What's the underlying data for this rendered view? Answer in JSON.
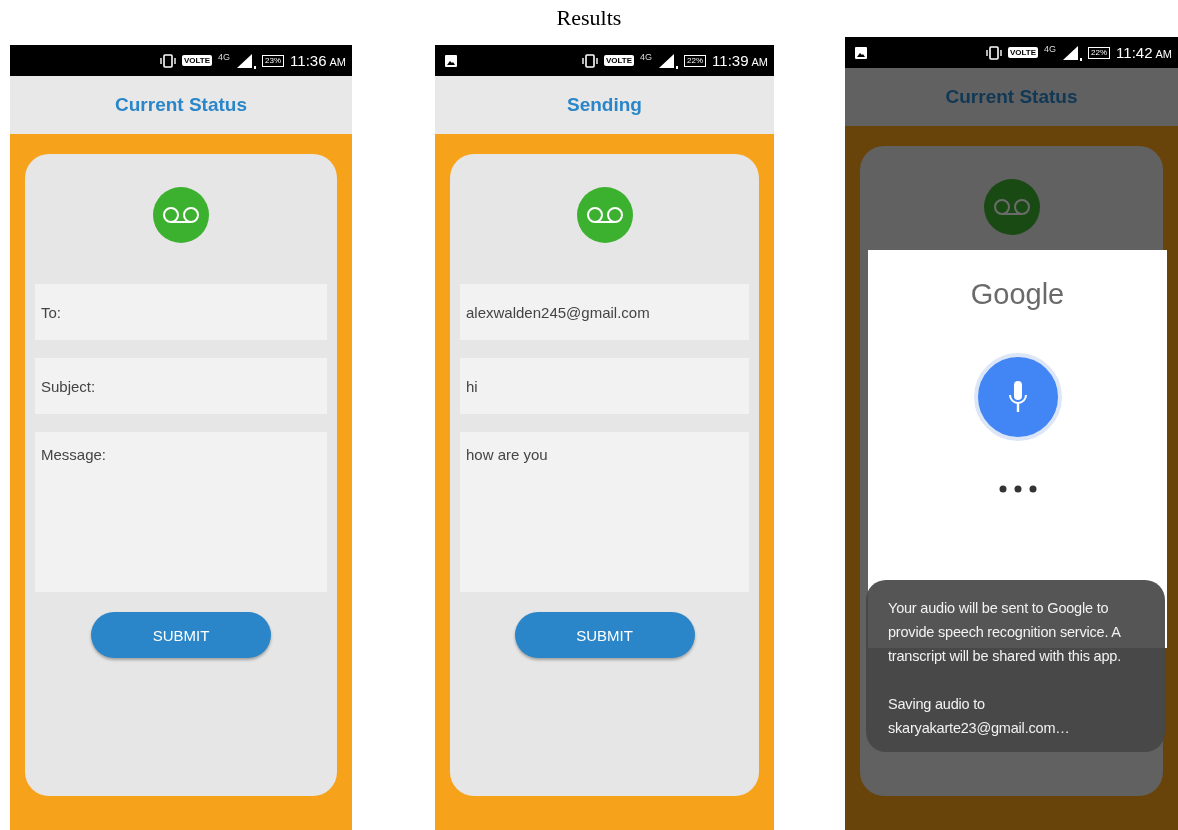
{
  "figure_title": "Results",
  "phones": [
    {
      "status_bar": {
        "notification_icon": false,
        "volte": "VOLTE",
        "network": "4G",
        "battery": "23%",
        "time": "11:36",
        "period": "AM"
      },
      "app_bar": {
        "title": "Current Status"
      },
      "dimmed": false,
      "form": {
        "fields": [
          {
            "kind": "line",
            "placeholder": "To:"
          },
          {
            "kind": "line",
            "placeholder": "Subject:"
          },
          {
            "kind": "area",
            "placeholder": "Message:"
          }
        ],
        "submit": "SUBMIT"
      }
    },
    {
      "status_bar": {
        "notification_icon": true,
        "volte": "VOLTE",
        "network": "4G",
        "battery": "22%",
        "time": "11:39",
        "period": "AM"
      },
      "app_bar": {
        "title": "Sending"
      },
      "dimmed": false,
      "form": {
        "fields": [
          {
            "kind": "line",
            "value": "alexwalden245@gmail.com"
          },
          {
            "kind": "line",
            "value": "hi"
          },
          {
            "kind": "area",
            "value": "how are you"
          }
        ],
        "submit": "SUBMIT"
      }
    },
    {
      "status_bar": {
        "notification_icon": true,
        "volte": "VOLTE",
        "network": "4G",
        "battery": "22%",
        "time": "11:42",
        "period": "AM"
      },
      "app_bar": {
        "title": "Current Status"
      },
      "dimmed": true,
      "dialog": {
        "logo": "Google",
        "message": "Your audio will be sent to Google to provide speech recognition service. A transcript will be shared with this app.",
        "saving_label": "Saving audio to",
        "account": "skaryakarte23@gmail.com…"
      }
    }
  ]
}
